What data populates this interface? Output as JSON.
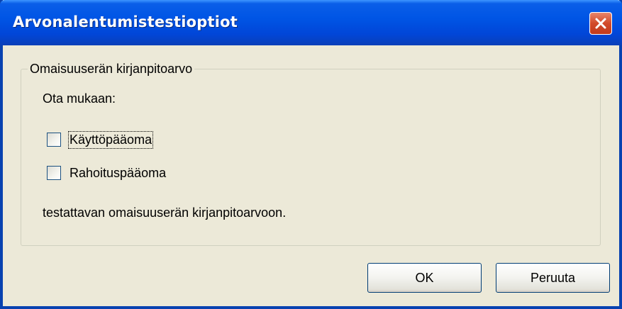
{
  "window": {
    "title": "Arvonalentumistestioptiot"
  },
  "group": {
    "legend": "Omaisuuserän kirjanpitoarvo",
    "include_label": "Ota mukaan:",
    "checkboxes": [
      {
        "label": "Käyttöpääoma",
        "checked": false
      },
      {
        "label": "Rahoituspääoma",
        "checked": false
      }
    ],
    "footer_text": "testattavan omaisuuserän kirjanpitoarvoon."
  },
  "buttons": {
    "ok_label": "OK",
    "cancel_label": "Peruuta"
  },
  "icons": {
    "close": "close-icon"
  },
  "colors": {
    "titlebar": "#0055e5",
    "window_bg": "#ece9d8",
    "close_button": "#d24a2a"
  }
}
